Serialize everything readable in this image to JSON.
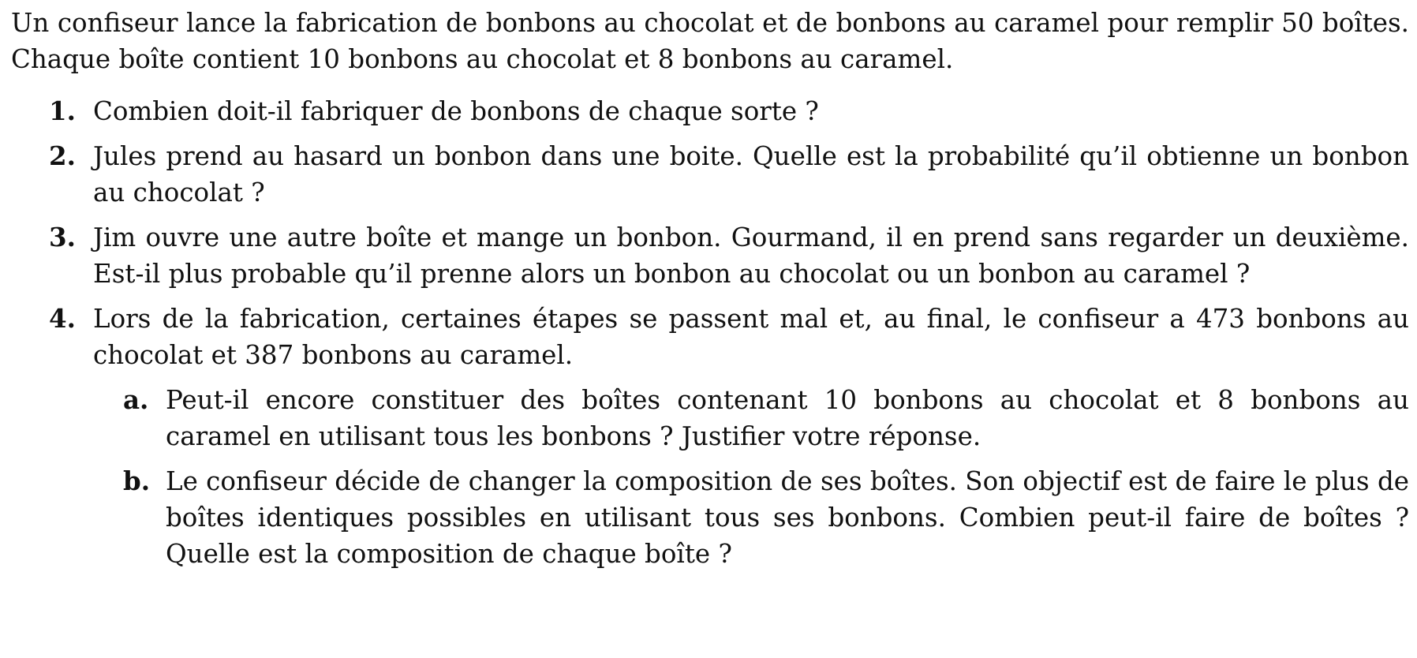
{
  "exercise": {
    "intro": "Un confiseur lance la fabrication de bonbons au chocolat et de bonbons au caramel pour remplir 50 boîtes. Chaque boîte contient 10 bonbons au chocolat et 8 bonbons au caramel.",
    "questions": [
      {
        "number": "1.",
        "text": "Combien doit-il fabriquer de bonbons de chaque sorte ?"
      },
      {
        "number": "2.",
        "text": "Jules prend au hasard un bonbon dans une boite. Quelle est la probabilité qu’il obtienne un bonbon au chocolat ?"
      },
      {
        "number": "3.",
        "text": "Jim ouvre une autre boîte et mange un bonbon. Gourmand, il en prend sans regarder un deuxième. Est-il plus probable qu’il prenne alors un bonbon au chocolat ou un bonbon au caramel ?"
      },
      {
        "number": "4.",
        "text": "Lors de la fabrication, certaines étapes se passent mal et, au final, le confiseur a 473 bonbons au chocolat et 387 bonbons au caramel.",
        "subquestions": [
          {
            "number": "a.",
            "text": "Peut-il encore constituer des boîtes contenant 10 bonbons au chocolat et 8 bonbons au caramel en utilisant tous les bonbons ? Justifier votre réponse."
          },
          {
            "number": "b.",
            "text": "Le confiseur décide de changer la composition de ses boîtes. Son objectif est de faire le plus de boîtes identiques possibles en utilisant tous ses bonbons. Combien peut-il faire de boîtes ? Quelle est la composition de chaque boîte ?"
          }
        ]
      }
    ]
  }
}
